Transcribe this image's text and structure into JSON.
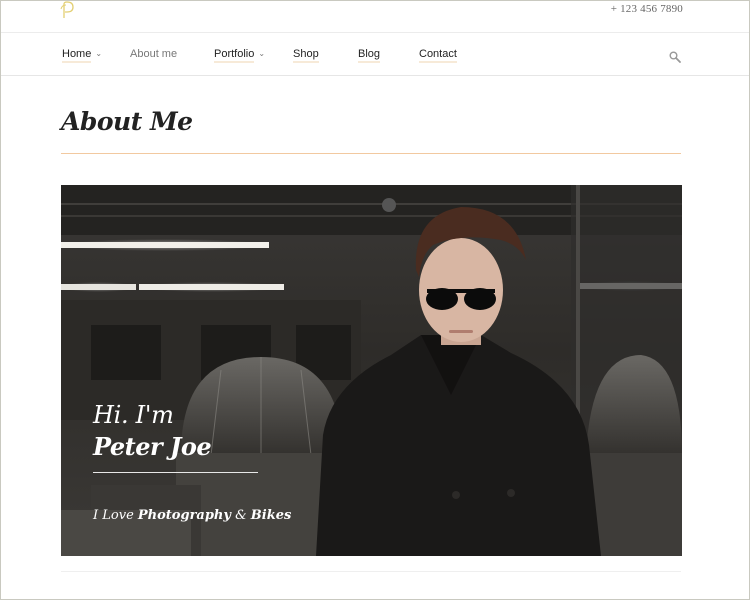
{
  "header": {
    "phone": "+ 123 456 7890"
  },
  "nav": {
    "items": [
      {
        "label": "Home"
      },
      {
        "label": "About me"
      },
      {
        "label": "Portfolio"
      },
      {
        "label": "Shop"
      },
      {
        "label": "Blog"
      },
      {
        "label": "Contact"
      }
    ]
  },
  "page": {
    "title": "About Me"
  },
  "hero": {
    "greeting": "Hi. I'm",
    "name": "Peter Joe",
    "tagline_prefix": "I Love",
    "tagline_1": "Photography",
    "tagline_amp": "&",
    "tagline_2": "Bikes"
  },
  "colors": {
    "accent": "#f2c9a0",
    "logo": "#e3cf73"
  },
  "icons": {
    "logo": "logo-icon",
    "search": "search-icon",
    "caret": "chevron-down-icon"
  }
}
